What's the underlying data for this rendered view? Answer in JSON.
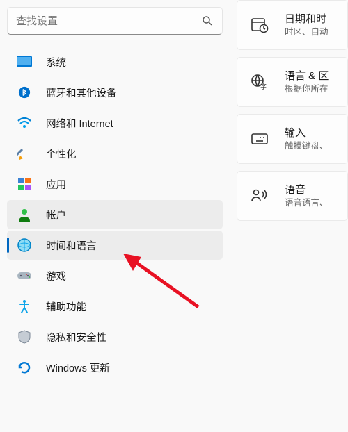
{
  "search": {
    "placeholder": "查找设置"
  },
  "nav": [
    {
      "key": "system",
      "label": "系统"
    },
    {
      "key": "bluetooth",
      "label": "蓝牙和其他设备"
    },
    {
      "key": "network",
      "label": "网络和 Internet"
    },
    {
      "key": "personalization",
      "label": "个性化"
    },
    {
      "key": "apps",
      "label": "应用"
    },
    {
      "key": "accounts",
      "label": "帐户"
    },
    {
      "key": "time_language",
      "label": "时间和语言"
    },
    {
      "key": "gaming",
      "label": "游戏"
    },
    {
      "key": "accessibility",
      "label": "辅助功能"
    },
    {
      "key": "privacy",
      "label": "隐私和安全性"
    },
    {
      "key": "update",
      "label": "Windows 更新"
    }
  ],
  "content_cards": [
    {
      "key": "datetime",
      "title": "日期和时",
      "sub": "时区、自动"
    },
    {
      "key": "language_region",
      "title": "语言 & 区",
      "sub": "根据你所在"
    },
    {
      "key": "typing",
      "title": "输入",
      "sub": "触摸键盘、"
    },
    {
      "key": "speech",
      "title": "语音",
      "sub": "语音语言、"
    }
  ]
}
